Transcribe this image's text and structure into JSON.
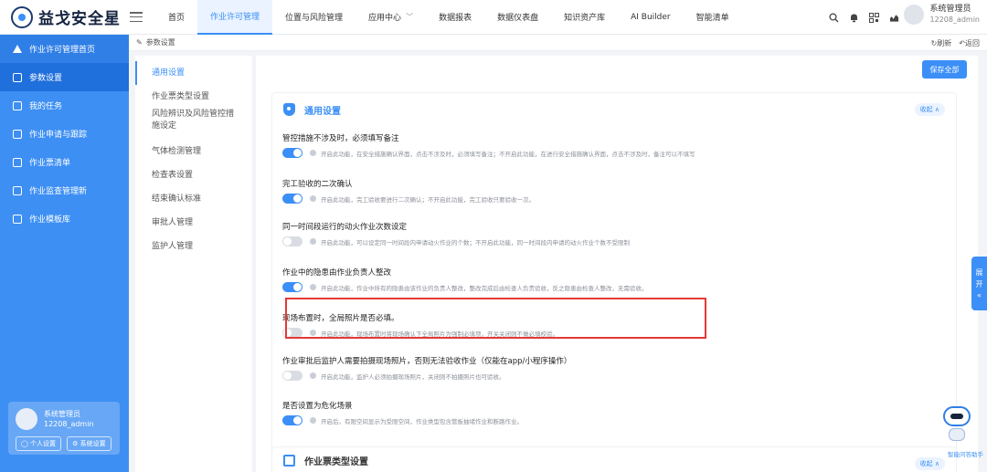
{
  "app": {
    "logo_text": "益戈安全星"
  },
  "nav": {
    "items": [
      {
        "label": "首页",
        "active": false,
        "caret": false
      },
      {
        "label": "作业许可管理",
        "active": true,
        "caret": false
      },
      {
        "label": "位置与风险管理",
        "active": false,
        "caret": false
      },
      {
        "label": "应用中心",
        "active": false,
        "caret": true
      },
      {
        "label": "数据报表",
        "active": false,
        "caret": false
      },
      {
        "label": "数据仪表盘",
        "active": false,
        "caret": false
      },
      {
        "label": "知识资产库",
        "active": false,
        "caret": false
      },
      {
        "label": "AI Builder",
        "active": false,
        "caret": false
      },
      {
        "label": "智能清单",
        "active": false,
        "caret": false
      }
    ],
    "caret_glyph": "﹀",
    "icons": [
      "search-icon",
      "bell-icon",
      "qrcode-icon",
      "chart-icon"
    ]
  },
  "user_top": {
    "name": "系统管理员",
    "id": "12208_admin"
  },
  "sidebar": {
    "items": [
      {
        "label": "作业许可管理首页",
        "icon": "warning-icon"
      },
      {
        "label": "参数设置",
        "icon": "doc-icon"
      },
      {
        "label": "我的任务",
        "icon": "doc-icon"
      },
      {
        "label": "作业申请与跟踪",
        "icon": "doc-icon"
      },
      {
        "label": "作业票清单",
        "icon": "doc-icon"
      },
      {
        "label": "作业监查管理新",
        "icon": "doc-icon"
      },
      {
        "label": "作业模板库",
        "icon": "doc-icon"
      }
    ],
    "user_card": {
      "name": "系统管理员",
      "id": "12208_admin",
      "personal_label": "个人设置",
      "system_label": "系统设置"
    }
  },
  "breadcrumb": {
    "icon": "✎",
    "label": "参数设置",
    "refresh": "刷新",
    "back": "返回"
  },
  "inner_menu": [
    "通用设置",
    "作业票类型设置",
    "风险辨识及风险管控措施设定",
    "气体检测管理",
    "检查表设置",
    "结束确认标准",
    "审批人管理",
    "监护人管理"
  ],
  "content": {
    "save_all": "保存全部",
    "collapse": "收起 ∧",
    "card1_title": "通用设置",
    "settings": [
      {
        "title": "管控措施不涉及时，必须填写备注",
        "on": true,
        "desc": "开启此功能，在安全措施确认界面，点击不涉及时，必须填写备注；不开启此功能，在进行安全措施确认界面，点击不涉及时，备注可以不填写"
      },
      {
        "title": "完工验收的二次确认",
        "on": true,
        "desc": "开启此功能，完工验收要进行二次确认；不开启此功能，完工验收只要验收一次。"
      },
      {
        "title": "同一时间段运行的动火作业次数设定",
        "on": false,
        "desc": "开启此功能，可以设定同一时间段内申请动火作业的个数；不开启此功能，同一时间段内申请的动火作业个数不受限制"
      },
      {
        "title": "作业中的隐患由作业负责人整改",
        "on": true,
        "desc": "开启此功能，作业中所有的隐患由该作业的负责人整改，整改完成后由检查人负责验收，反之隐患由检查人整改，无需验收。"
      },
      {
        "title": "现场布置时，全局照片是否必填。",
        "on": false,
        "desc": "开启此功能，现场布置时将现场确认下全局照片为强制必填项，开关关闭则不做必填校验。"
      },
      {
        "title": "作业审批后监护人需要拍摄现场照片，否则无法验收作业（仅能在app/小程序操作）",
        "on": false,
        "desc": "开启此功能，监护人必须拍摄现场照片，关闭则不拍摄照片也可验收。"
      },
      {
        "title": "是否设置为危化场景",
        "on": true,
        "desc": "开启后，有限空间显示为受限空间，作业类型包含管板抽堵作业和断路作业。"
      }
    ],
    "card2_title": "作业票类型设置"
  },
  "expand_tab": {
    "chars": [
      "展",
      "开",
      "«"
    ]
  },
  "bot": {
    "label": "智能问答助手"
  }
}
